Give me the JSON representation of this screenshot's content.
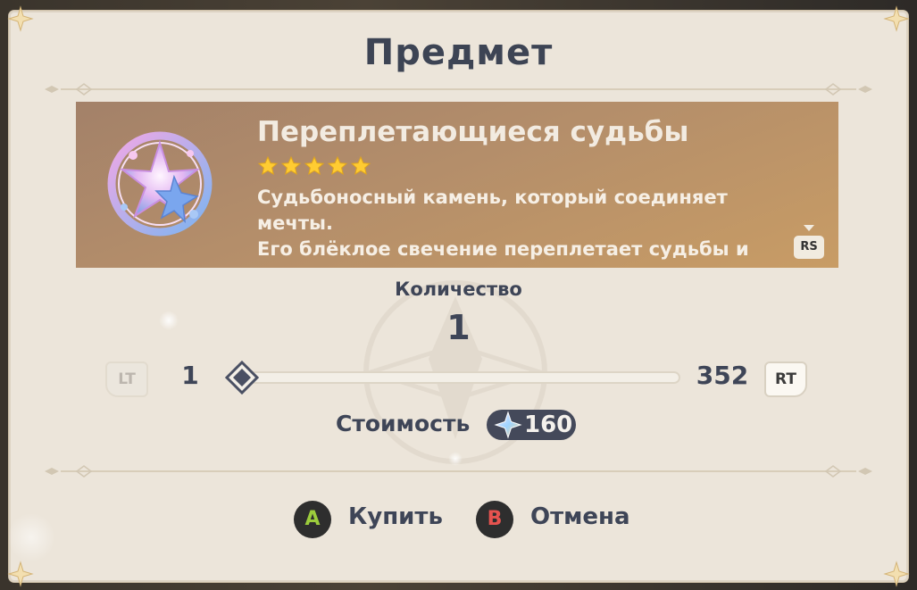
{
  "dialog": {
    "title": "Предмет"
  },
  "item": {
    "name": "Переплетающиеся судьбы",
    "rarity_stars": 5,
    "description_lines": [
      "Судьбоносный камень, который соединяет",
      "мечты.",
      "Его блёклое свечение переплетает судьбы и"
    ],
    "scroll_hint": "RS",
    "icon": "intertwined-fate-icon"
  },
  "quantity": {
    "label": "Количество",
    "value": "1",
    "min": "1",
    "max": "352",
    "slider_fraction": 0,
    "decrease_trigger": "LT",
    "increase_trigger": "RT"
  },
  "cost": {
    "label": "Стоимость",
    "value": "160",
    "currency_icon": "primogem-icon"
  },
  "actions": {
    "confirm_key": "A",
    "confirm_label": "Купить",
    "cancel_key": "B",
    "cancel_label": "Отмена"
  },
  "colors": {
    "panel": "#ece5da",
    "text": "#3e4557",
    "card": "#b48e6a",
    "star": "#ffcc32",
    "button_a": "#9ccc3c",
    "button_b": "#e6534f"
  }
}
